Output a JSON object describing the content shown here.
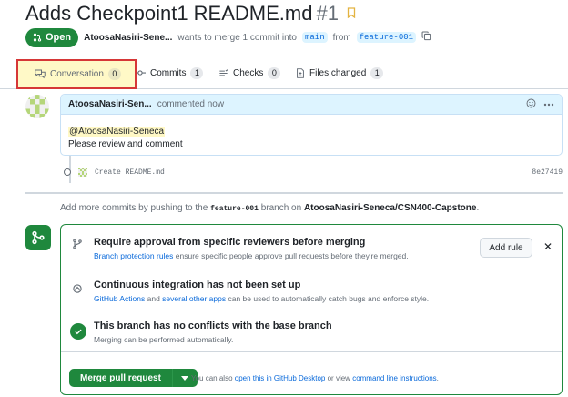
{
  "pr": {
    "title": "Adds Checkpoint1 README.md",
    "number": "#1",
    "state": "Open",
    "author": "AtoosaNasiri-Sene...",
    "merge_text": "wants to merge 1 commit into",
    "base_branch": "main",
    "from_text": "from",
    "head_branch": "feature-001"
  },
  "tabs": [
    {
      "label": "Conversation",
      "count": "0"
    },
    {
      "label": "Commits",
      "count": "1"
    },
    {
      "label": "Checks",
      "count": "0"
    },
    {
      "label": "Files changed",
      "count": "1"
    }
  ],
  "comment": {
    "author": "AtoosaNasiri-Sen...",
    "action": "commented now",
    "mention": "@AtoosaNasiri-Seneca",
    "body": "Please review and comment"
  },
  "commit": {
    "message": "Create README.md",
    "sha": "8e27419"
  },
  "hint": {
    "pre": "Add more commits by pushing to the",
    "branch": "feature-001",
    "mid": "branch on",
    "repo": "AtoosaNasiri-Seneca/CSN400-Capstone",
    "post": "."
  },
  "merge": {
    "approval_title": "Require approval from specific reviewers before merging",
    "approval_link": "Branch protection rules",
    "approval_desc": "ensure specific people approve pull requests before they're merged.",
    "add_rule": "Add rule",
    "ci_title": "Continuous integration has not been set up",
    "ci_link1": "GitHub Actions",
    "ci_and": "and",
    "ci_link2": "several other apps",
    "ci_desc": "can be used to automatically catch bugs and enforce style.",
    "conflict_title": "This branch has no conflicts with the base branch",
    "conflict_desc": "Merging can be performed automatically.",
    "button": "Merge pull request",
    "alt_pre": "You can also",
    "alt_link1": "open this in GitHub Desktop",
    "alt_mid": "or view",
    "alt_link2": "command line instructions",
    "alt_post": "."
  },
  "colors": {
    "accent_green": "#1f883d",
    "link_blue": "#0969da",
    "highlight_yellow": "#fff9c7",
    "annotation_red": "#d63737"
  }
}
